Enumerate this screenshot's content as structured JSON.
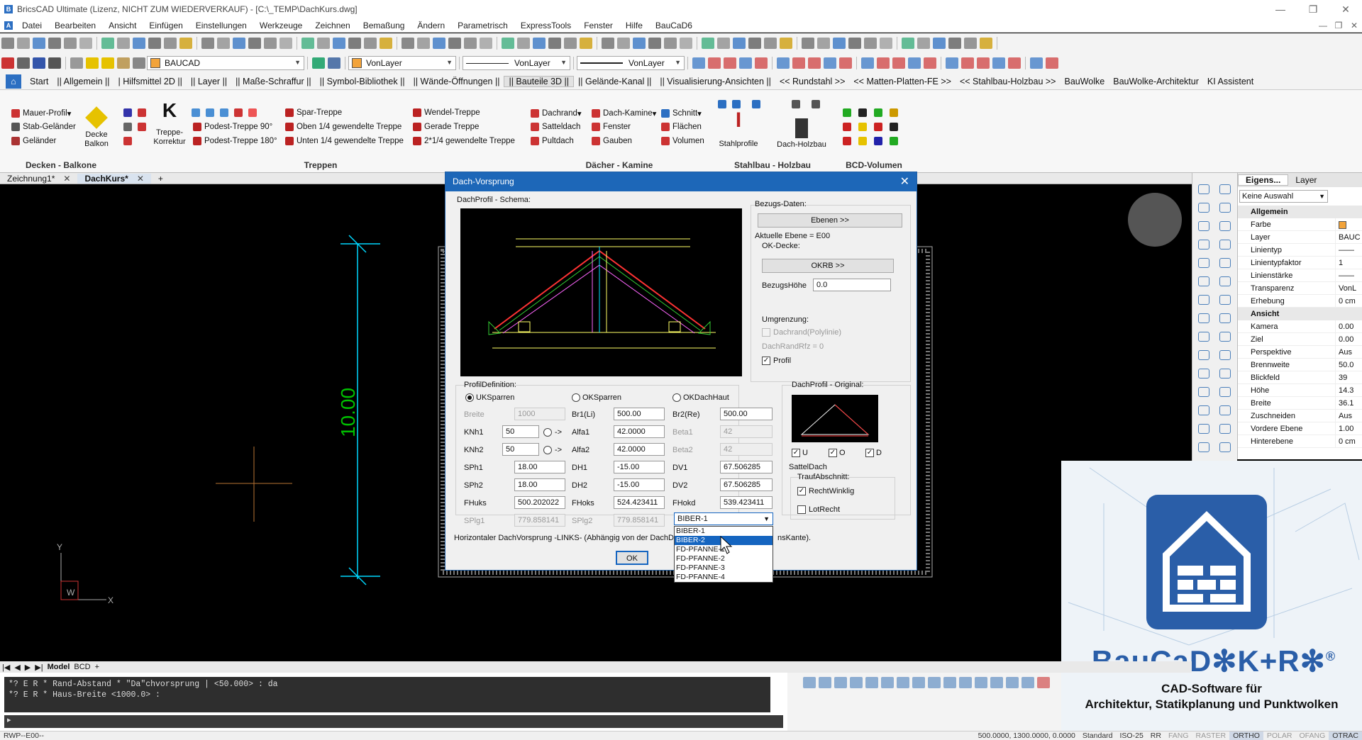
{
  "window": {
    "title": "BricsCAD Ultimate (Lizenz, NICHT ZUM WIEDERVERKAUF) - [C:\\_TEMP\\DachKurs.dwg]",
    "min": "—",
    "max": "❐",
    "close": "✕"
  },
  "menu": [
    "Datei",
    "Bearbeiten",
    "Ansicht",
    "Einfügen",
    "Einstellungen",
    "Werkzeuge",
    "Zeichnen",
    "Bemaßung",
    "Ändern",
    "Parametrisch",
    "ExpressTools",
    "Fenster",
    "Hilfe",
    "BauCaD6"
  ],
  "toolbar2": {
    "layer": "BAUCAD",
    "color": "VonLayer",
    "linetype": "VonLayer",
    "lineweight": "VonLayer"
  },
  "tabs": [
    "Start",
    "|| Allgemein ||",
    "| Hilfsmittel 2D ||",
    "|| Layer ||",
    "|| Maße-Schraffur ||",
    "|| Symbol-Bibliothek ||",
    "|| Wände-Öffnungen ||",
    "|| Bauteile 3D ||",
    "|| Gelände-Kanal ||",
    "|| Visualisierung-Ansichten ||",
    "<< Rundstahl >>",
    "<< Matten-Platten-FE >>",
    "<< Stahlbau-Holzbau >>",
    "BauWolke",
    "BauWolke-Architektur",
    "KI Assistent"
  ],
  "ribbon": {
    "p1": {
      "label": "Decken - Balkone",
      "items": [
        "Mauer-Profil",
        "Stab-Geländer",
        "Geländer"
      ],
      "big": "Decke Balkon"
    },
    "p2": {
      "label": "Treppen",
      "big": "Treppe-Korrektur",
      "col1": [
        "Spar-Treppe",
        "Podest-Treppe 90°",
        "Podest-Treppe 180°"
      ],
      "col2": [
        "Oben 1/4 gewendelte Treppe",
        "Unten 1/4 gewendelte Treppe"
      ],
      "col3": [
        "Wendel-Treppe",
        "Gerade Treppe",
        "2*1/4 gewendelte Treppe"
      ]
    },
    "p3": {
      "label": "Dächer - Kamine",
      "col1": [
        "Dachrand",
        "Satteldach",
        "Pultdach"
      ],
      "col2": [
        "Dach-Kamine",
        "Fenster",
        "Gauben"
      ],
      "col3": [
        "Schnitt",
        "Flächen",
        "Volumen"
      ]
    },
    "p4": {
      "label": "Stahlbau - Holzbau",
      "items": [
        "Stahlprofile",
        "Dach-Holzbau"
      ]
    },
    "p5": {
      "label": "BCD-Volumen"
    }
  },
  "doctabs": [
    "Zeichnung1*",
    "DachKurs*"
  ],
  "canvas": {
    "dim": "10.00",
    "ucs_y": "Y",
    "ucs_x": "X",
    "ucs_w": "W"
  },
  "props": {
    "tab1": "Eigens...",
    "tab2": "Layer",
    "selection": "Keine Auswahl",
    "sections": [
      {
        "name": "Allgemein",
        "rows": [
          [
            "Farbe",
            ""
          ],
          [
            "Layer",
            "BAUC"
          ],
          [
            "Linientyp",
            "——"
          ],
          [
            "Linientypfaktor",
            "1"
          ],
          [
            "Linienstärke",
            "——"
          ],
          [
            "Transparenz",
            "VonL"
          ],
          [
            "Erhebung",
            "0 cm"
          ]
        ]
      },
      {
        "name": "Ansicht",
        "rows": [
          [
            "Kamera",
            "0.00"
          ],
          [
            "Ziel",
            "0.00"
          ],
          [
            "Perspektive",
            "Aus"
          ],
          [
            "Brennweite",
            "50.0"
          ],
          [
            "Blickfeld",
            "39"
          ],
          [
            "Höhe",
            "14.3"
          ],
          [
            "Breite",
            "36.1"
          ],
          [
            "Zuschneiden",
            "Aus"
          ],
          [
            "Vordere Ebene",
            "1.00"
          ],
          [
            "Hinterebene",
            "0 cm"
          ]
        ]
      }
    ]
  },
  "ad": {
    "brand": "BauCaD✻K+R✻",
    "reg": "®",
    "line1": "CAD-Software für",
    "line2": "Architektur, Statikplanung und Punktwolken"
  },
  "layouttabs": {
    "model": "Model",
    "bcd": "BCD",
    "plus": "+"
  },
  "cmd": {
    "lines": [
      "*? E R * Rand-Abstand * \"Da\"chvorsprung | <50.000> : da",
      "*? E R * Haus-Breite <1000.0> :"
    ],
    "prompt": "▸"
  },
  "status": {
    "left": "RWP--E00--",
    "coords": "500.0000, 1300.0000, 0.0000",
    "items": [
      "Standard",
      "ISO-25",
      "RR",
      "FANG",
      "RASTER",
      "ORTHO",
      "POLAR",
      "OFANG",
      "OTRAC"
    ]
  },
  "dialog": {
    "title": "Dach-Vorsprung",
    "close": "✕",
    "schema_label": "DachProfil - Schema:",
    "bezug_label": "Bezugs-Daten:",
    "ebenen_btn": "Ebenen >>",
    "aktuelle": "Aktuelle Ebene = E00",
    "okdecke_label": "OK-Decke:",
    "okrb_btn": "OKRB >>",
    "bezugshoehe_label": "BezugsHöhe",
    "bezugshoehe": "0.0",
    "umgrenzung_label": "Umgrenzung:",
    "dachrand_label": "Dachrand(Polylinie)",
    "dachrandrfz": "DachRandRfz = 0",
    "profil_label": "Profil",
    "profil_check": "✓",
    "profdef_label": "ProfilDefinition:",
    "radio1": "UKSparren",
    "radio2": "OKSparren",
    "radio3": "OKDachHaut",
    "breite_label": "Breite",
    "breite": "1000",
    "knh1_label": "KNh1",
    "knh1": "50",
    "knh2_label": "KNh2",
    "knh2": "50",
    "arrow": "->",
    "br1_label": "Br1(Li)",
    "br1": "500.00",
    "br2_label": "Br2(Re)",
    "br2": "500.00",
    "alfa1_label": "Alfa1",
    "alfa1": "42.0000",
    "beta1_label": "Beta1",
    "beta1": "42",
    "alfa2_label": "Alfa2",
    "alfa2": "42.0000",
    "beta2_label": "Beta2",
    "beta2": "42",
    "sph1_label": "SPh1",
    "sph1": "18.00",
    "dh1_label": "DH1",
    "dh1": "-15.00",
    "dv1_label": "DV1",
    "dv1": "67.506285",
    "sph2_label": "SPh2",
    "sph2": "18.00",
    "dh2_label": "DH2",
    "dh2": "-15.00",
    "dv2_label": "DV2",
    "dv2": "67.506285",
    "fhuks_label": "FHuks",
    "fhuks": "500.202022",
    "fhoks_label": "FHoks",
    "fhoks": "524.423411",
    "fhokd_label": "FHokd",
    "fhokd": "539.423411",
    "splg1_label": "SPlg1",
    "splg1": "779.858141",
    "splg2_label": "SPlg2",
    "splg2": "779.858141",
    "dropdown_value": "BIBER-1",
    "dropdown_options": [
      "BIBER-1",
      "BIBER-2",
      "FD-PFANNE-1",
      "FD-PFANNE-2",
      "FD-PFANNE-3",
      "FD-PFANNE-4"
    ],
    "dropdown_selected": 1,
    "original_label": "DachProfil - Original:",
    "chk_u": "U",
    "chk_o": "O",
    "chk_d": "D",
    "check": "✓",
    "satteldach": "SattelDach",
    "trauf_label": "TraufAbschnitt:",
    "rechtwinklig": "RechtWinklig",
    "lotrecht": "LotRecht",
    "hint_left": "Horizontaler DachVorsprung -LINKS- (Abhängig von der DachDe",
    "hint_right": "nsKante).",
    "ok_btn": "OK"
  },
  "colors": {
    "accent": "#1d67b8",
    "cyan": "#00e0ff",
    "green": "#00c000"
  }
}
